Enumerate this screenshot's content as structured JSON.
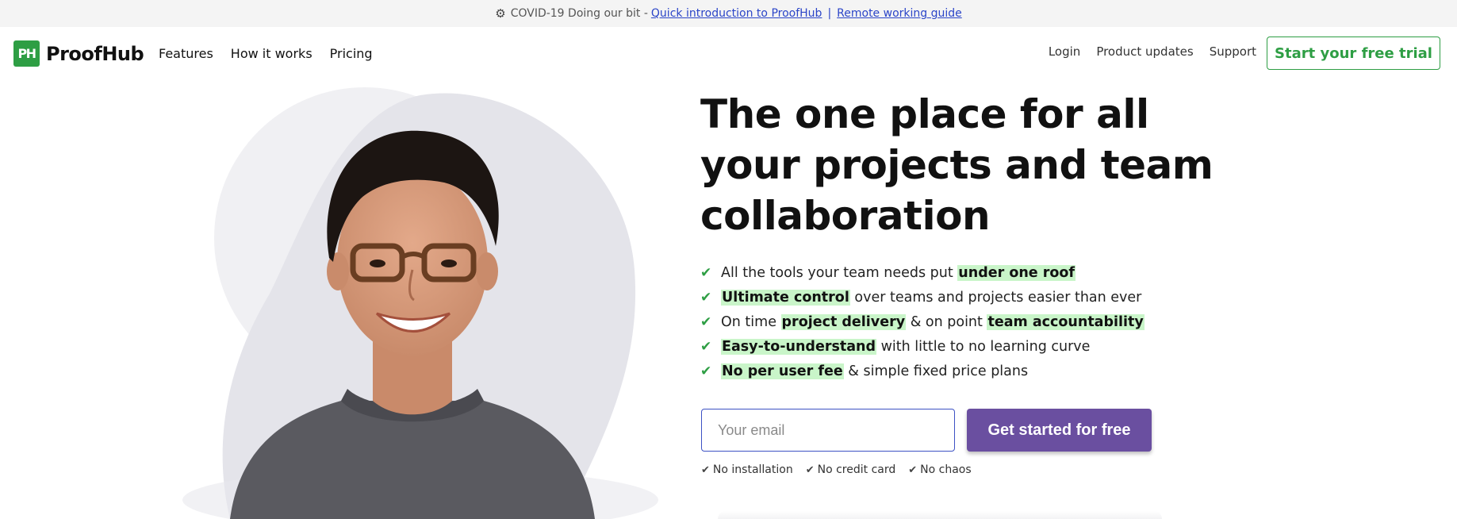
{
  "announcement": {
    "gear_icon": "⚙",
    "prefix": "COVID-19 Doing our bit -",
    "link1": "Quick introduction to ProofHub",
    "separator": "|",
    "link2": "Remote working guide"
  },
  "brand": {
    "logo_mark": "PH",
    "name": "ProofHub",
    "color": "#2e9e44"
  },
  "nav": {
    "items": [
      "Features",
      "How it works",
      "Pricing"
    ]
  },
  "right_nav": {
    "login": "Login",
    "product_updates": "Product updates",
    "support": "Support",
    "trial_button": "Start your free trial"
  },
  "hero": {
    "headline": "The one place for all your projects and team collaboration",
    "features": [
      [
        {
          "t": "All the tools your team needs put ",
          "h": false
        },
        {
          "t": "under one roof",
          "h": true
        }
      ],
      [
        {
          "t": "Ultimate control",
          "h": true
        },
        {
          "t": " over teams and projects easier than ever",
          "h": false
        }
      ],
      [
        {
          "t": "On time ",
          "h": false
        },
        {
          "t": "project delivery",
          "h": true
        },
        {
          "t": " & on point ",
          "h": false
        },
        {
          "t": "team accountability",
          "h": true
        }
      ],
      [
        {
          "t": "Easy-to-understand",
          "h": true
        },
        {
          "t": " with little to no learning curve",
          "h": false
        }
      ],
      [
        {
          "t": "No per user fee",
          "h": true
        },
        {
          "t": " & simple fixed price plans",
          "h": false
        }
      ]
    ],
    "email_placeholder": "Your email",
    "cta_label": "Get started for free",
    "notes": [
      "No installation",
      "No credit card",
      "No chaos"
    ]
  },
  "colors": {
    "accent_green": "#2e9e44",
    "cta_purple": "#6a4fa0",
    "highlight": "#c9f5c9",
    "link_blue": "#2b45c8"
  }
}
